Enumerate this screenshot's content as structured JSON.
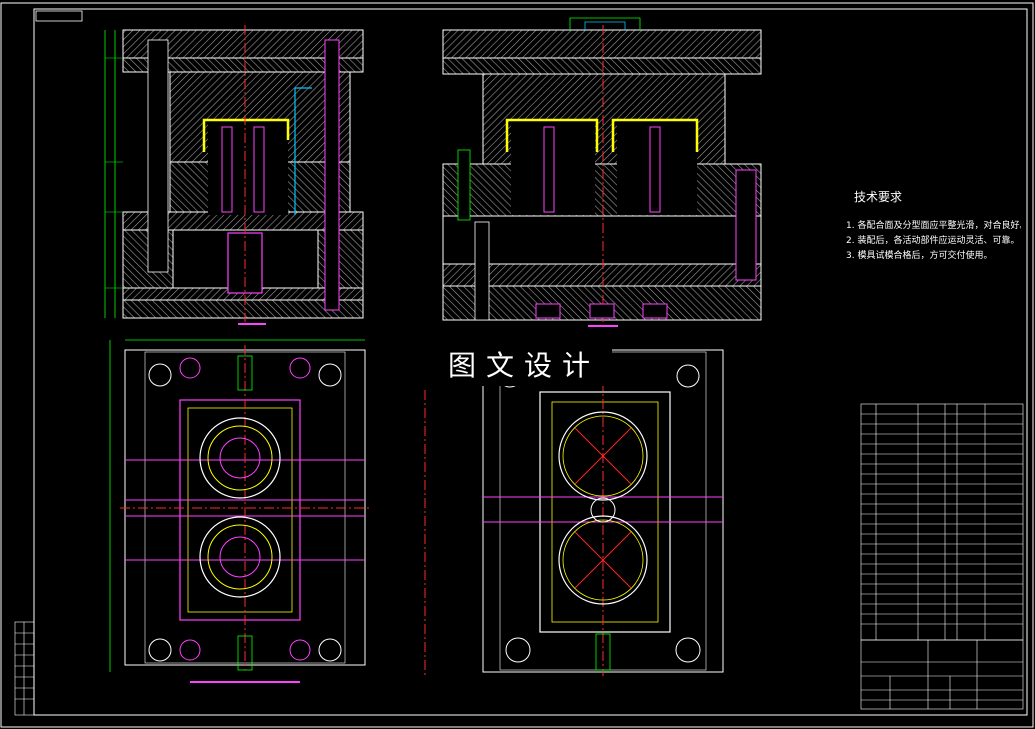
{
  "watermark": "图文设计",
  "tech_title": "技术要求",
  "tech_notes": [
    "1. 各配合面及分型面应平整光滑，对合良好。",
    "2. 装配后，各活动部件应运动灵活、可靠。",
    "3. 模具试模合格后，方可交付使用。"
  ],
  "colors": {
    "background": "#000000",
    "frame": "#ffffff",
    "hatch": "#b8b8b8",
    "cavity_outline": "#ffff00",
    "centerline": "#ff2a2a",
    "dimension": "#00ff00",
    "pins": "#ff40ff",
    "cooling": "#00c8ff"
  },
  "icons": [
    "mold-front-section",
    "mold-side-section",
    "moving-half-plan",
    "fixed-half-plan",
    "parts-list-table",
    "title-block"
  ]
}
